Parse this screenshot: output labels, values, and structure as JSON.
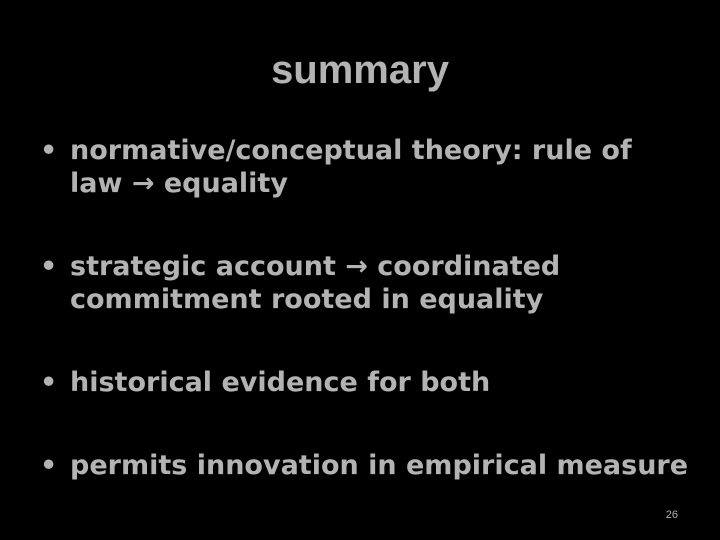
{
  "slide": {
    "title": "summary",
    "bullet_glyph": "•",
    "bullets": [
      {
        "text": "normative/conceptual theory: rule of law → equality"
      },
      {
        "text": "strategic account  → coordinated commitment rooted in equality"
      },
      {
        "text": "historical evidence for both"
      },
      {
        "text": "permits innovation in empirical measure"
      }
    ],
    "page_number": "26"
  },
  "colors": {
    "background": "#000000",
    "text": "#b3b3b3"
  }
}
